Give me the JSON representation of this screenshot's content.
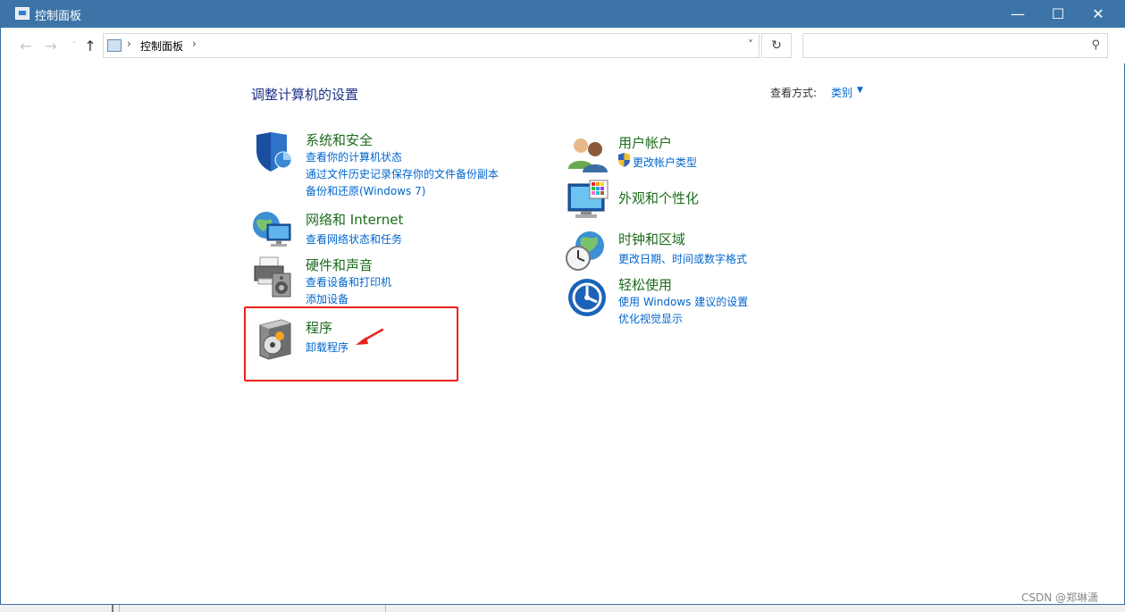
{
  "window": {
    "title": "控制面板"
  },
  "titlebar_buttons": {
    "minimize": "—",
    "maximize": "☐",
    "close": "✕"
  },
  "nav": {
    "back": "←",
    "forward": "→",
    "recent": "˅",
    "up": "↑"
  },
  "address": {
    "separator": "›",
    "crumb": "控制面板",
    "dropdown": "˅",
    "refresh": "↻"
  },
  "search": {
    "placeholder": "",
    "icon_glyph": "⚲"
  },
  "page": {
    "title": "调整计算机的设置"
  },
  "view_by": {
    "label": "查看方式:",
    "value": "类别",
    "arrow": "▼"
  },
  "categories": [
    {
      "name": "系统和安全",
      "icon": "shield-icon",
      "links": [
        "查看你的计算机状态",
        "通过文件历史记录保存你的文件备份副本",
        "备份和还原(Windows 7)"
      ]
    },
    {
      "name": "网络和 Internet",
      "icon": "network-globe-icon",
      "links": [
        "查看网络状态和任务"
      ]
    },
    {
      "name": "硬件和声音",
      "icon": "printer-speaker-icon",
      "links": [
        "查看设备和打印机",
        "添加设备"
      ]
    },
    {
      "name": "程序",
      "icon": "programs-disc-icon",
      "links": [
        "卸载程序"
      ]
    },
    {
      "name": "用户帐户",
      "icon": "users-icon",
      "links": [
        "更改帐户类型"
      ]
    },
    {
      "name": "外观和个性化",
      "icon": "monitor-palette-icon",
      "links": []
    },
    {
      "name": "时钟和区域",
      "icon": "clock-globe-icon",
      "links": [
        "更改日期、时间或数字格式"
      ]
    },
    {
      "name": "轻松使用",
      "icon": "ease-of-access-icon",
      "links": [
        "使用 Windows 建议的设置",
        "优化视觉显示"
      ]
    }
  ],
  "colors": {
    "titlebar": "#3c74a8",
    "heading": "#1d6b1d",
    "link": "#0066cc",
    "page_title": "#1e3287",
    "highlight": "#e8231e"
  },
  "watermark": "CSDN @郑琳潇"
}
